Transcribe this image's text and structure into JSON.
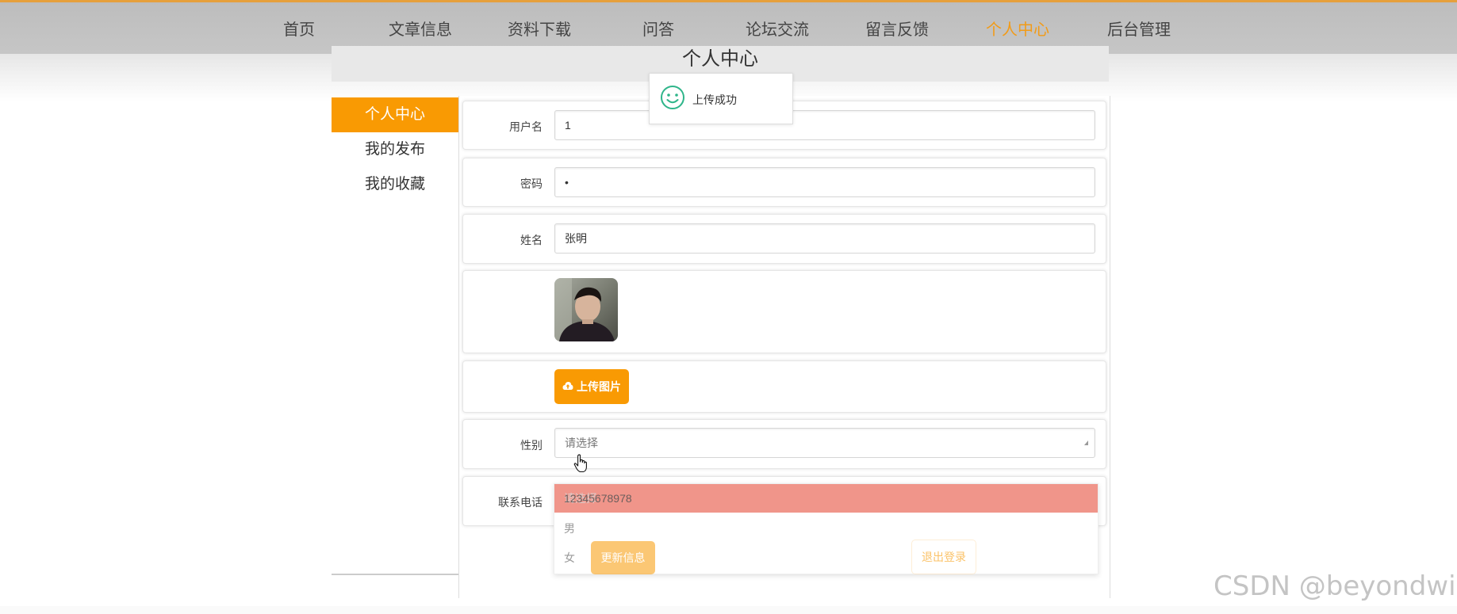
{
  "nav": {
    "items": [
      "首页",
      "文章信息",
      "资料下载",
      "问答",
      "论坛交流",
      "留言反馈",
      "个人中心",
      "后台管理"
    ],
    "active_index": 6
  },
  "page": {
    "title": "个人中心"
  },
  "sidebar": {
    "items": [
      "个人中心",
      "我的发布",
      "我的收藏"
    ],
    "active_index": 0
  },
  "form": {
    "username": {
      "label": "用户名",
      "value": "1"
    },
    "password": {
      "label": "密码",
      "value": "•"
    },
    "name": {
      "label": "姓名",
      "value": "张明"
    },
    "avatar": {
      "description": "user-photo"
    },
    "upload_button": "上传图片",
    "gender": {
      "label": "性别",
      "placeholder": "请选择",
      "options": [
        "请选择",
        "男",
        "女"
      ]
    },
    "phone": {
      "label": "联系电话",
      "value": "12345678978"
    },
    "update_button": "更新信息",
    "logout_button": "退出登录"
  },
  "toast": {
    "message": "上传成功",
    "icon": "smile-icon"
  },
  "watermark": "CSDN @beyondwild",
  "colors": {
    "accent": "#f99a03",
    "nav_active": "#f29b17",
    "toast_icon": "#2fb58a",
    "dropdown_highlight": "#f0958a"
  }
}
